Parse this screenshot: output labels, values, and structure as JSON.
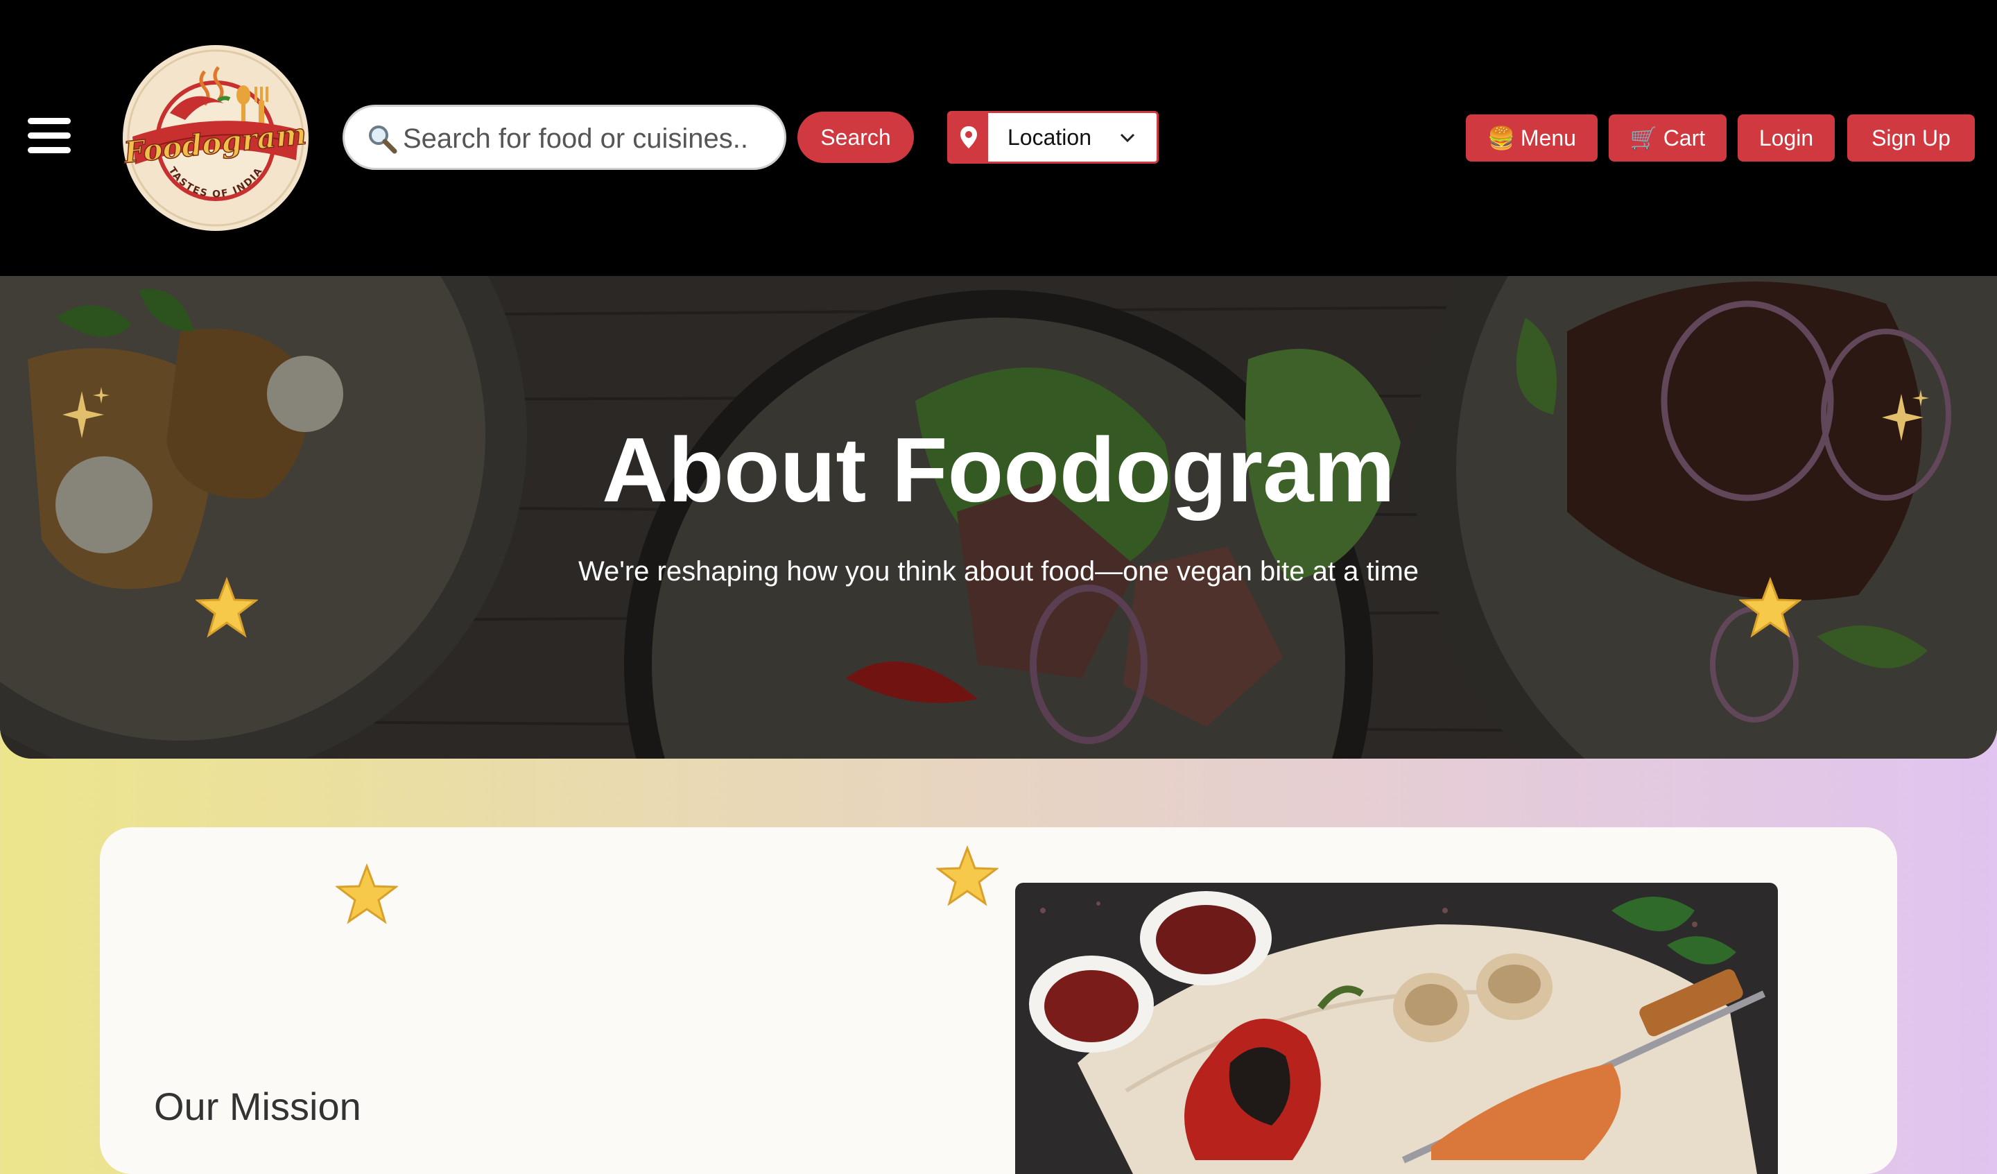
{
  "header": {
    "logo": {
      "brand_text": "Foodogram",
      "tagline": "TASTES OF INDIA"
    },
    "search": {
      "placeholder": "Search for food or cuisines..",
      "button_label": "Search"
    },
    "location": {
      "label": "Location"
    },
    "nav": {
      "menu_label": "Menu",
      "menu_icon": "🍔",
      "cart_label": "Cart",
      "cart_icon": "🛒",
      "login_label": "Login",
      "signup_label": "Sign Up"
    }
  },
  "hero": {
    "title": "About Foodogram",
    "subtitle": "We're reshaping how you think about food—one vegan bite at a time"
  },
  "mission": {
    "title": "Our Mission"
  },
  "colors": {
    "accent": "#d0393f",
    "header_bg": "#000000",
    "card_bg": "#fcfaf6"
  }
}
